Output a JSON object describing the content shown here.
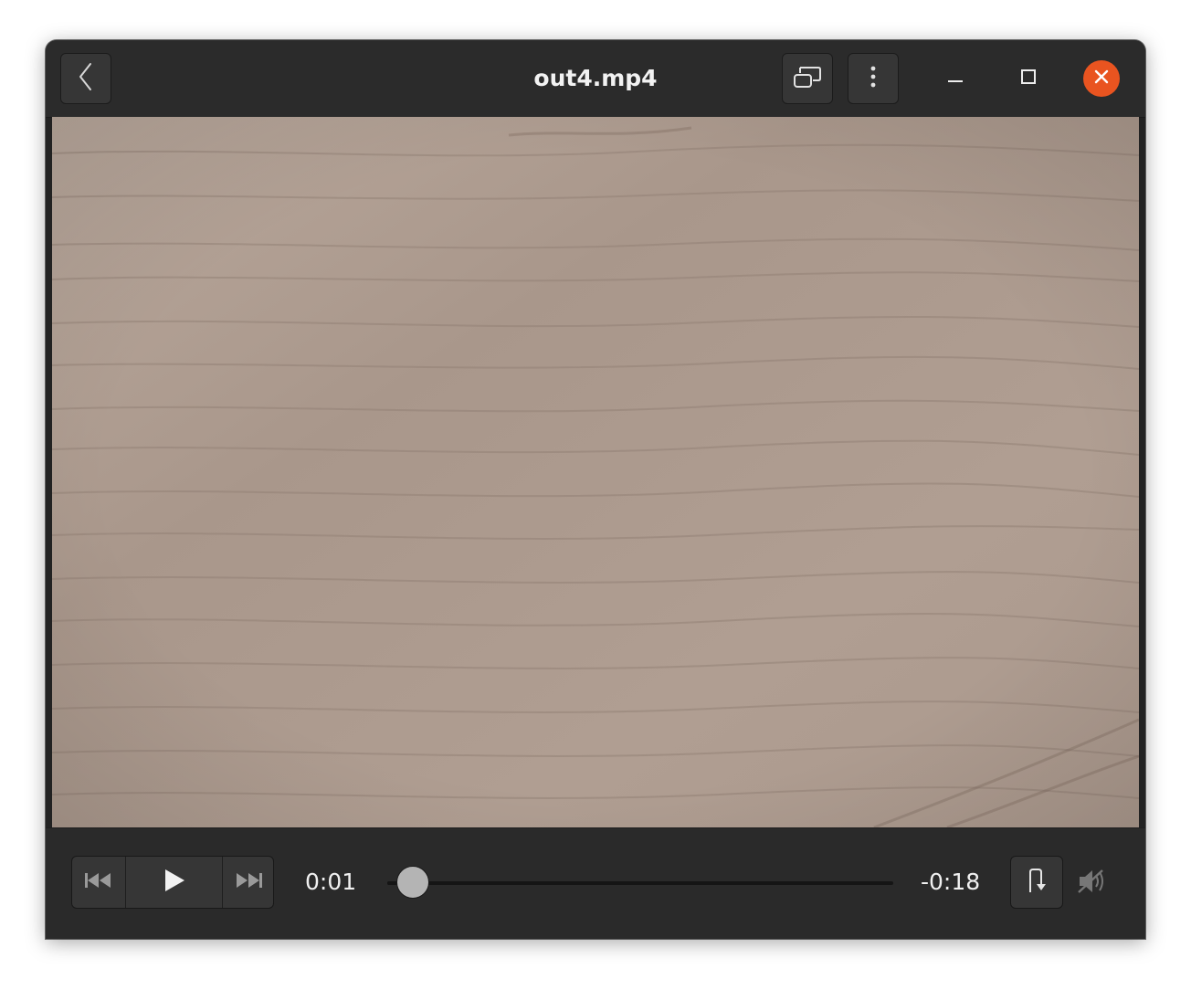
{
  "window": {
    "title": "out4.mp4"
  },
  "header": {
    "back_icon": "chevron-left-icon",
    "pip_icon": "picture-in-picture-icon",
    "menu_icon": "vertical-dots-icon",
    "minimize_icon": "minimize-icon",
    "maximize_icon": "maximize-icon",
    "close_icon": "close-icon",
    "close_color": "#e95420"
  },
  "video": {
    "content": "wood-grain-surface"
  },
  "controls": {
    "elapsed": "0:01",
    "remaining": "-0:18",
    "progress": 0.05,
    "prev_icon": "skip-backward-icon",
    "play_icon": "play-icon",
    "next_icon": "skip-forward-icon",
    "repeat_icon": "repeat-icon",
    "volume_icon": "volume-muted-icon"
  }
}
